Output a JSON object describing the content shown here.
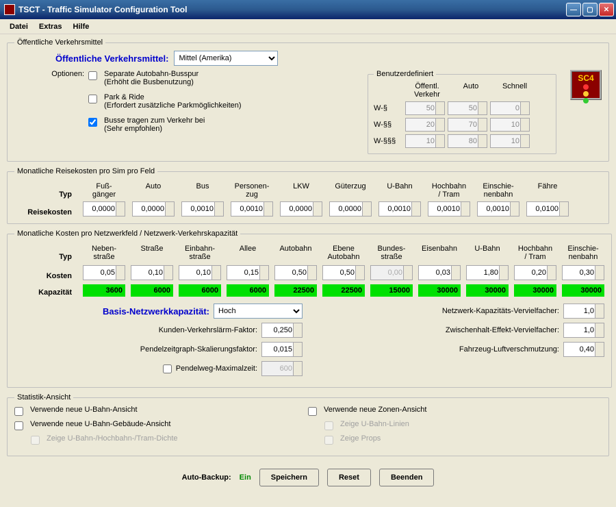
{
  "window": {
    "title": "TSCT - Traffic Simulator Configuration Tool"
  },
  "menu": {
    "file": "Datei",
    "extras": "Extras",
    "help": "Hilfe"
  },
  "opv": {
    "legend": "Öffentliche Verkehrsmittel",
    "label": "Öffentliche Verkehrsmittel:",
    "selected": "Mittel (Amerika)",
    "options_label": "Optionen:",
    "opts": [
      {
        "text": "Separate Autobahn-Busspur",
        "sub": "(Erhöht die Busbenutzung)",
        "checked": false
      },
      {
        "text": "Park & Ride",
        "sub": "(Erfordert zusätzliche Parkmöglichkeiten)",
        "checked": false
      },
      {
        "text": "Busse tragen zum Verkehr bei",
        "sub": "(Sehr empfohlen)",
        "checked": true
      }
    ],
    "userdef": {
      "legend": "Benutzerdefiniert",
      "cols": [
        "Öffentl. Verkehr",
        "Auto",
        "Schnell"
      ],
      "rows": [
        {
          "label": "W-§",
          "vals": [
            "50",
            "50",
            "0"
          ]
        },
        {
          "label": "W-§§",
          "vals": [
            "20",
            "70",
            "10"
          ]
        },
        {
          "label": "W-§§§",
          "vals": [
            "10",
            "80",
            "10"
          ]
        }
      ]
    }
  },
  "travel": {
    "legend": "Monatliche Reisekosten pro Sim pro Feld",
    "typ": "Typ",
    "row_label": "Reisekosten",
    "cols": [
      {
        "head": "Fuß-\ngänger",
        "val": "0,0000"
      },
      {
        "head": "Auto",
        "val": "0,0000"
      },
      {
        "head": "Bus",
        "val": "0,0010"
      },
      {
        "head": "Personen-\nzug",
        "val": "0,0010"
      },
      {
        "head": "LKW",
        "val": "0,0000"
      },
      {
        "head": "Güterzug",
        "val": "0,0000"
      },
      {
        "head": "U-Bahn",
        "val": "0,0010"
      },
      {
        "head": "Hochbahn\n/ Tram",
        "val": "0,0010"
      },
      {
        "head": "Einschie-\nnenbahn",
        "val": "0,0010"
      },
      {
        "head": "Fähre",
        "val": "0,0100"
      }
    ]
  },
  "network": {
    "legend": "Monatliche Kosten pro Netzwerkfeld / Netzwerk-Verkehrskapazität",
    "typ": "Typ",
    "cost_label": "Kosten",
    "cap_label": "Kapazität",
    "cols": [
      {
        "head": "Neben-\nstraße",
        "cost": "0,05",
        "cap": "3600",
        "disabled": false
      },
      {
        "head": "Straße",
        "cost": "0,10",
        "cap": "6000",
        "disabled": false
      },
      {
        "head": "Einbahn-\nstraße",
        "cost": "0,10",
        "cap": "6000",
        "disabled": false
      },
      {
        "head": "Allee",
        "cost": "0,15",
        "cap": "6000",
        "disabled": false
      },
      {
        "head": "Autobahn",
        "cost": "0,50",
        "cap": "22500",
        "disabled": false
      },
      {
        "head": "Ebene\nAutobahn",
        "cost": "0,50",
        "cap": "22500",
        "disabled": false
      },
      {
        "head": "Bundes-\nstraße",
        "cost": "0,00",
        "cap": "15000",
        "disabled": true
      },
      {
        "head": "Eisenbahn",
        "cost": "0,03",
        "cap": "30000",
        "disabled": false
      },
      {
        "head": "U-Bahn",
        "cost": "1,80",
        "cap": "30000",
        "disabled": false
      },
      {
        "head": "Hochbahn\n/ Tram",
        "cost": "0,20",
        "cap": "30000",
        "disabled": false
      },
      {
        "head": "Einschie-\nnenbahn",
        "cost": "0,30",
        "cap": "30000",
        "disabled": false
      }
    ],
    "base_cap_label": "Basis-Netzwerkkapazität:",
    "base_cap_value": "Hoch",
    "left_params": [
      {
        "label": "Kunden-Verkehrslärm-Faktor:",
        "val": "0,250"
      },
      {
        "label": "Pendelzeitgraph-Skalierungsfaktor:",
        "val": "0,015"
      }
    ],
    "commute_max_label": "Pendelweg-Maximalzeit:",
    "commute_max_val": "600",
    "right_params": [
      {
        "label": "Netzwerk-Kapazitäts-Vervielfacher:",
        "val": "1,0"
      },
      {
        "label": "Zwischenhalt-Effekt-Vervielfacher:",
        "val": "1,0"
      },
      {
        "label": "Fahrzeug-Luftverschmutzung:",
        "val": "0,40"
      }
    ]
  },
  "stats": {
    "legend": "Statistik-Ansicht",
    "left": [
      {
        "text": "Verwende neue U-Bahn-Ansicht",
        "checked": false,
        "enabled": true,
        "indent": false
      },
      {
        "text": "Verwende neue U-Bahn-Gebäude-Ansicht",
        "checked": false,
        "enabled": true,
        "indent": false
      },
      {
        "text": "Zeige U-Bahn-/Hochbahn-/Tram-Dichte",
        "checked": false,
        "enabled": false,
        "indent": true
      }
    ],
    "right": [
      {
        "text": "Verwende neue Zonen-Ansicht",
        "checked": false,
        "enabled": true,
        "indent": false
      },
      {
        "text": "Zeige U-Bahn-Linien",
        "checked": false,
        "enabled": false,
        "indent": true
      },
      {
        "text": "Zeige Props",
        "checked": false,
        "enabled": false,
        "indent": true
      }
    ]
  },
  "footer": {
    "autobackup_label": "Auto-Backup:",
    "autobackup_value": "Ein",
    "save": "Speichern",
    "reset": "Reset",
    "quit": "Beenden"
  }
}
